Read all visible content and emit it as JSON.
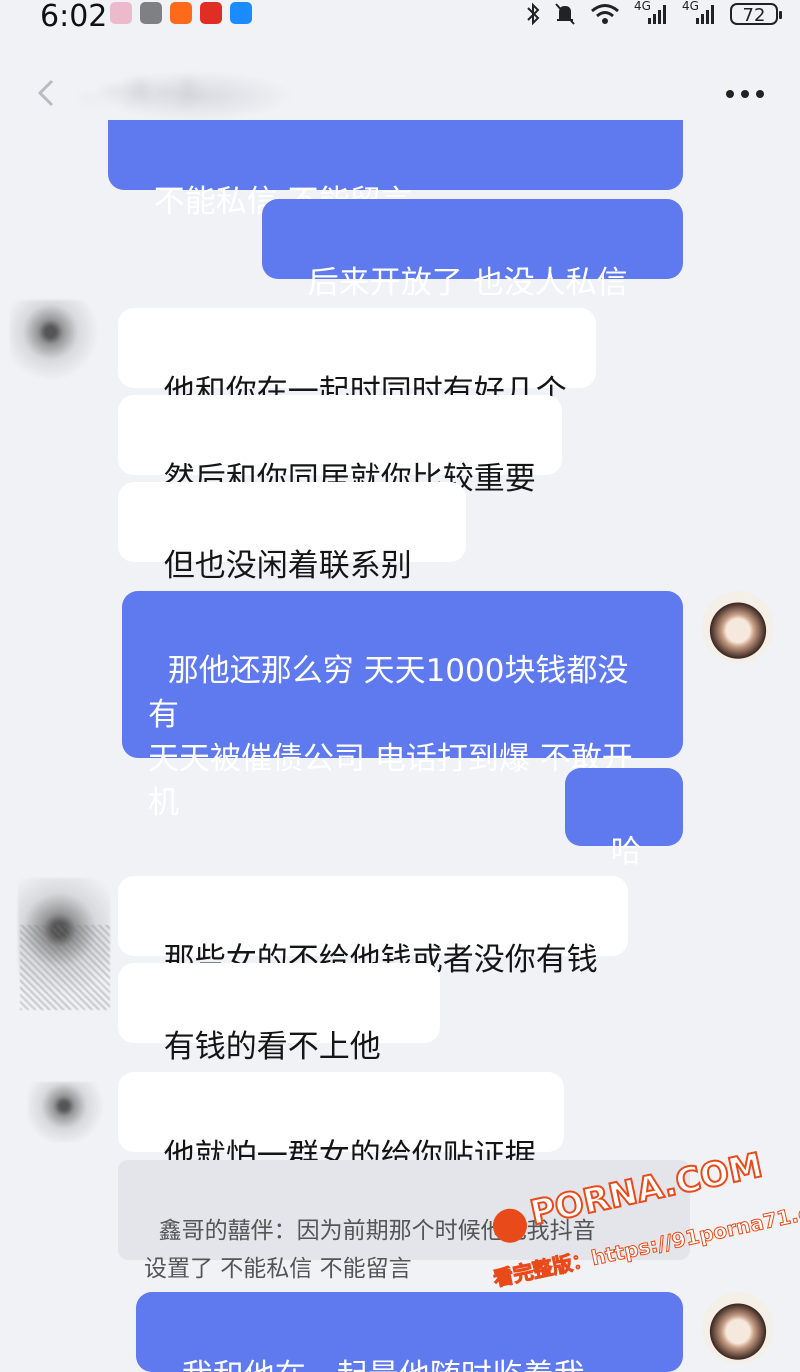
{
  "status_bar": {
    "time": "6:02",
    "network_1": "4G",
    "network_2": "4G",
    "battery": "72"
  },
  "header": {
    "title": "...一床一子"
  },
  "messages": [
    {
      "direction": "out",
      "text": "不能私信 不能留言"
    },
    {
      "direction": "out",
      "text": "后来开放了 也没人私信我"
    },
    {
      "direction": "in",
      "text": "他和你在一起时同时有好几个"
    },
    {
      "direction": "in",
      "text": "然后和你同居就你比较重要"
    },
    {
      "direction": "in",
      "text": "但也没闲着联系别人"
    },
    {
      "direction": "out",
      "text": "那他还那么穷 天天1000块钱都没有\n天天被催债公司 电话打到爆 不敢开\n机"
    },
    {
      "direction": "out",
      "text": "哈哈"
    },
    {
      "direction": "in",
      "text": "那些女的不给他钱或者没你有钱"
    },
    {
      "direction": "in",
      "text": "有钱的看不上他😂"
    },
    {
      "direction": "in",
      "text": "他就怕一群女的给你贴证据"
    },
    {
      "direction": "out",
      "text": "我和他在一起最他随时监着我…"
    }
  ],
  "quote": {
    "text": "鑫哥的囍伴：因为前期那个时候他把我抖音\n设置了 不能私信 不能留言"
  },
  "watermark": {
    "site": "PORNA.COM",
    "prefix": "91",
    "sub": "看完整版：https://91porna71.com"
  },
  "colors": {
    "outgoing_bubble": "#5f79ee",
    "incoming_bubble": "#ffffff",
    "background": "#f1f2f6",
    "quote_background": "#e4e5ea"
  }
}
